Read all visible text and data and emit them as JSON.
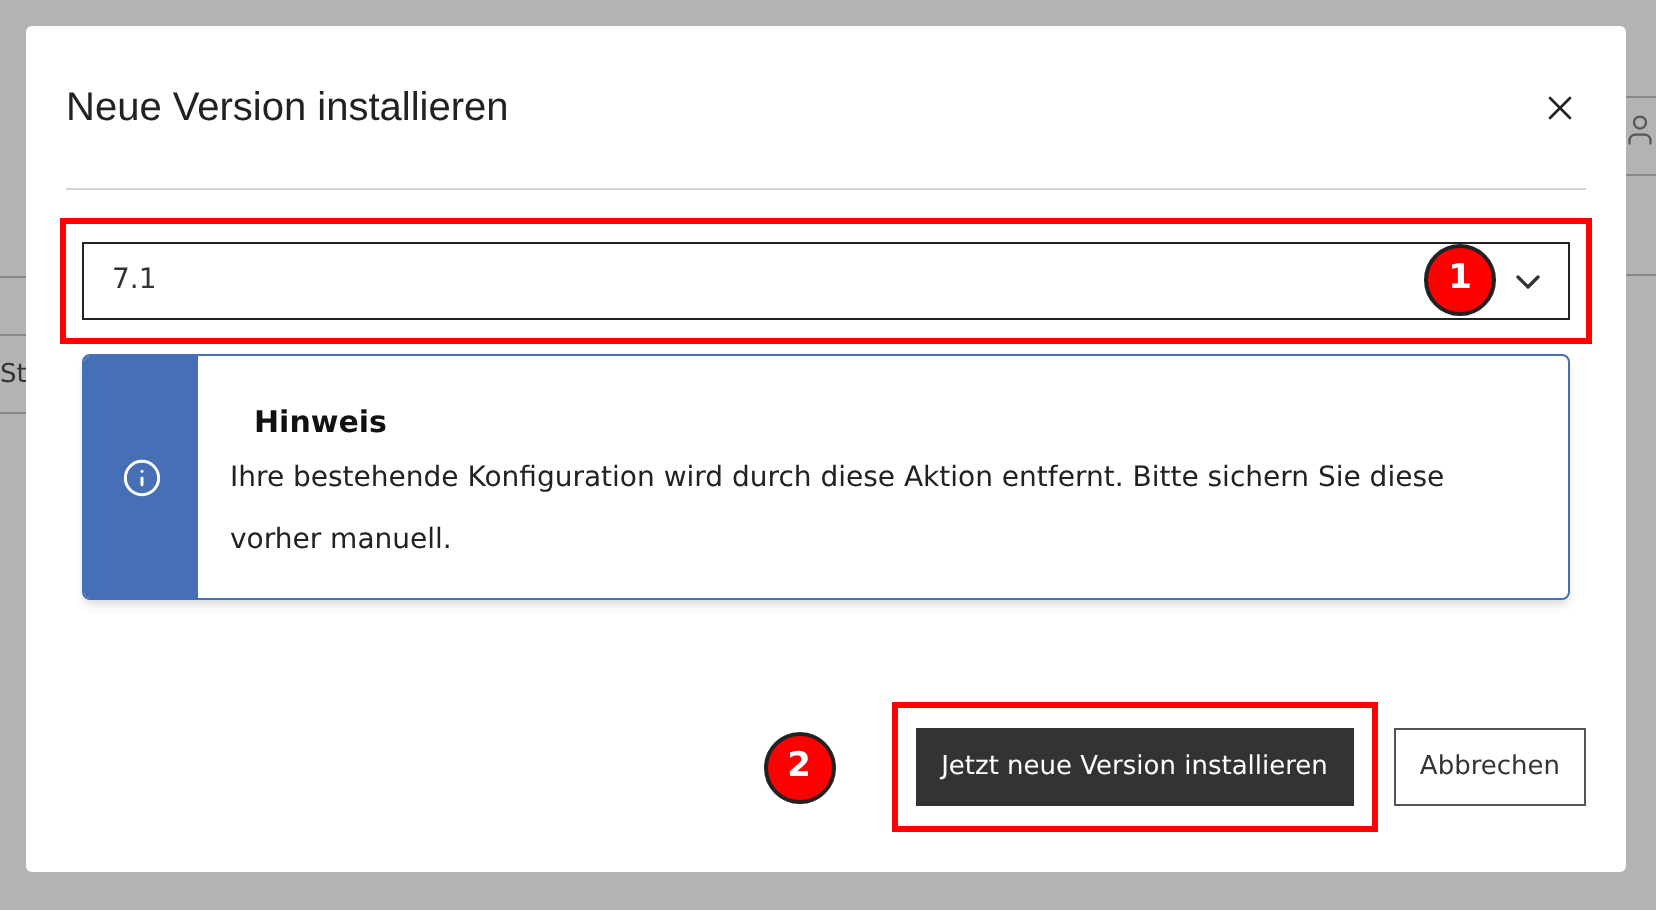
{
  "background": {
    "partial_label": "St"
  },
  "dialog": {
    "title": "Neue Version installieren",
    "version_select": {
      "value": "7.1"
    },
    "notice": {
      "title": "Hinweis",
      "text": "Ihre bestehende Konfiguration wird durch diese Aktion entfernt. Bitte sichern Sie diese vorher manuell."
    },
    "buttons": [
      {
        "label": "Jetzt neue Version installieren",
        "kind": "primary"
      },
      {
        "label": "Abbrechen",
        "kind": "secondary"
      }
    ]
  },
  "annotations": [
    {
      "label": "1"
    },
    {
      "label": "2"
    }
  ]
}
